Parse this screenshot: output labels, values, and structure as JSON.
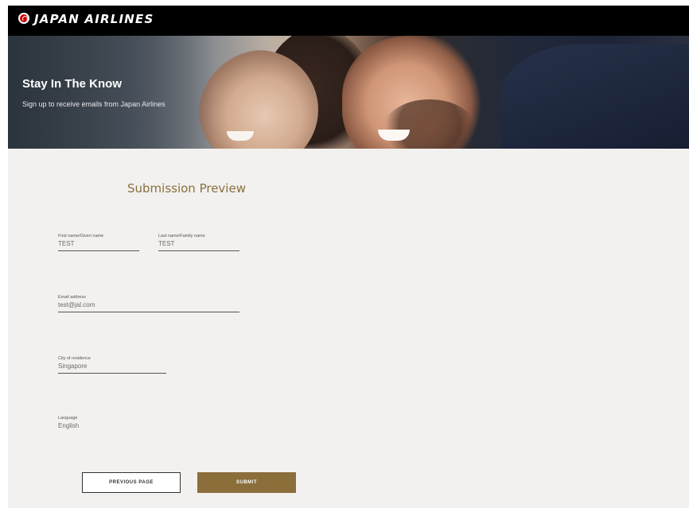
{
  "brand": {
    "name": "JAPAN AIRLINES",
    "accent_color": "#8b6e3a",
    "logo_color": "#cc0000"
  },
  "hero": {
    "title": "Stay In The Know",
    "subtitle": "Sign up to receive emails from Japan Airlines"
  },
  "preview": {
    "title": "Submission Preview",
    "fields": {
      "first_name": {
        "label": "First name/Given name",
        "value": "TEST"
      },
      "last_name": {
        "label": "Last name/Family name",
        "value": "TEST"
      },
      "email": {
        "label": "Email address",
        "value": "test@jal.com"
      },
      "city": {
        "label": "City of residence",
        "value": "Singapore"
      },
      "language": {
        "label": "Language",
        "value": "English"
      }
    }
  },
  "actions": {
    "previous_label": "PREVIOUS PAGE",
    "submit_label": "SUBMIT"
  }
}
